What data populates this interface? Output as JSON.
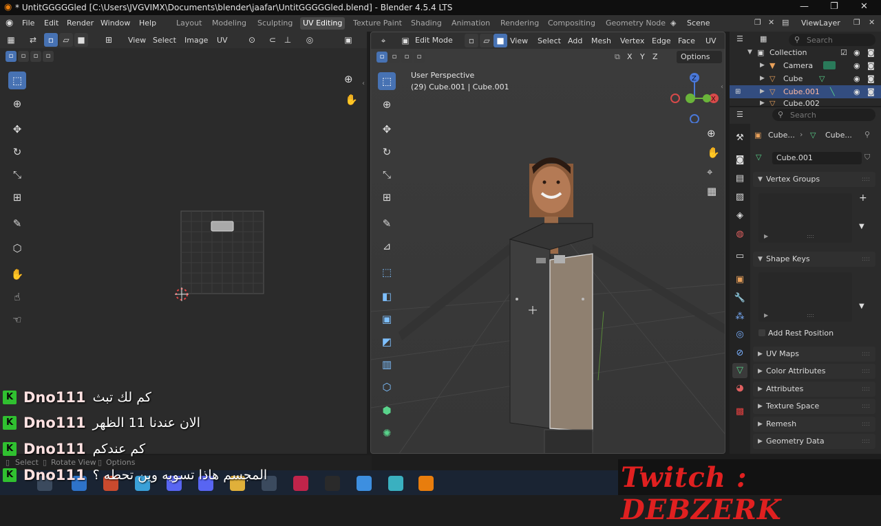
{
  "window": {
    "title": "* UntitGGGGGled [C:\\Users\\JVGVIMX\\Documents\\blender\\jaafar\\UntitGGGGGled.blend] - Blender 4.5.4 LTS",
    "minimize": "—",
    "maximize": "❐",
    "close": "✕"
  },
  "menubar": {
    "items": [
      "File",
      "Edit",
      "Render",
      "Window",
      "Help"
    ]
  },
  "workspaces": {
    "tabs": [
      "Layout",
      "Modeling",
      "Sculpting",
      "UV Editing",
      "Texture Paint",
      "Shading",
      "Animation",
      "Rendering",
      "Compositing",
      "Geometry Node"
    ],
    "active": "UV Editing"
  },
  "scene": {
    "name": "Scene"
  },
  "view_layer": {
    "name": "ViewLayer"
  },
  "uv_editor": {
    "menus": [
      "View",
      "Select",
      "Image",
      "UV"
    ]
  },
  "viewport": {
    "mode": "Edit Mode",
    "menus": [
      "View",
      "Select",
      "Add",
      "Mesh",
      "Vertex",
      "Edge",
      "Face",
      "UV"
    ],
    "axes": [
      "X",
      "Y",
      "Z"
    ],
    "options_label": "Options",
    "perspective_label": "User Perspective",
    "object_info": "(29) Cube.001 | Cube.001"
  },
  "outliner": {
    "search_placeholder": "Search",
    "rows": [
      {
        "name": "Collection"
      },
      {
        "name": "Camera"
      },
      {
        "name": "Cube"
      },
      {
        "name": "Cube.001"
      },
      {
        "name": "Cube.002"
      }
    ]
  },
  "properties": {
    "search_placeholder": "Search",
    "breadcrumb_object": "Cube...",
    "breadcrumb_mesh": "Cube...",
    "mesh_name": "Cube.001",
    "sections": {
      "vertex_groups": "Vertex Groups",
      "shape_keys": "Shape Keys",
      "add_rest_position": "Add Rest Position",
      "uv_maps": "UV Maps",
      "color_attributes": "Color Attributes",
      "attributes": "Attributes",
      "texture_space": "Texture Space",
      "remesh": "Remesh",
      "geometry_data": "Geometry Data"
    },
    "list_handle": "::::"
  },
  "statusbar": {
    "select": "Select",
    "rotate_view": "Rotate View",
    "options": "Options"
  },
  "chat": [
    {
      "badge": "K",
      "user": "Dno111",
      "message": "كم لك تبث"
    },
    {
      "badge": "K",
      "user": "Dno111",
      "message": "الان عندنا 11 الظهر"
    },
    {
      "badge": "K",
      "user": "Dno111",
      "message": "كم عندكم"
    },
    {
      "badge": "K",
      "user": "Dno111",
      "message": "المجسم هاذا تسويه وين تحطه ؟"
    }
  ],
  "twitch_banner": "Twitch : DEBZERK",
  "colors": {
    "accent": "#4772b3",
    "selected_row": "#334d80",
    "face_fill": "#8f8070",
    "chat_badge": "#30c030",
    "twitch_text": "#e02020"
  }
}
